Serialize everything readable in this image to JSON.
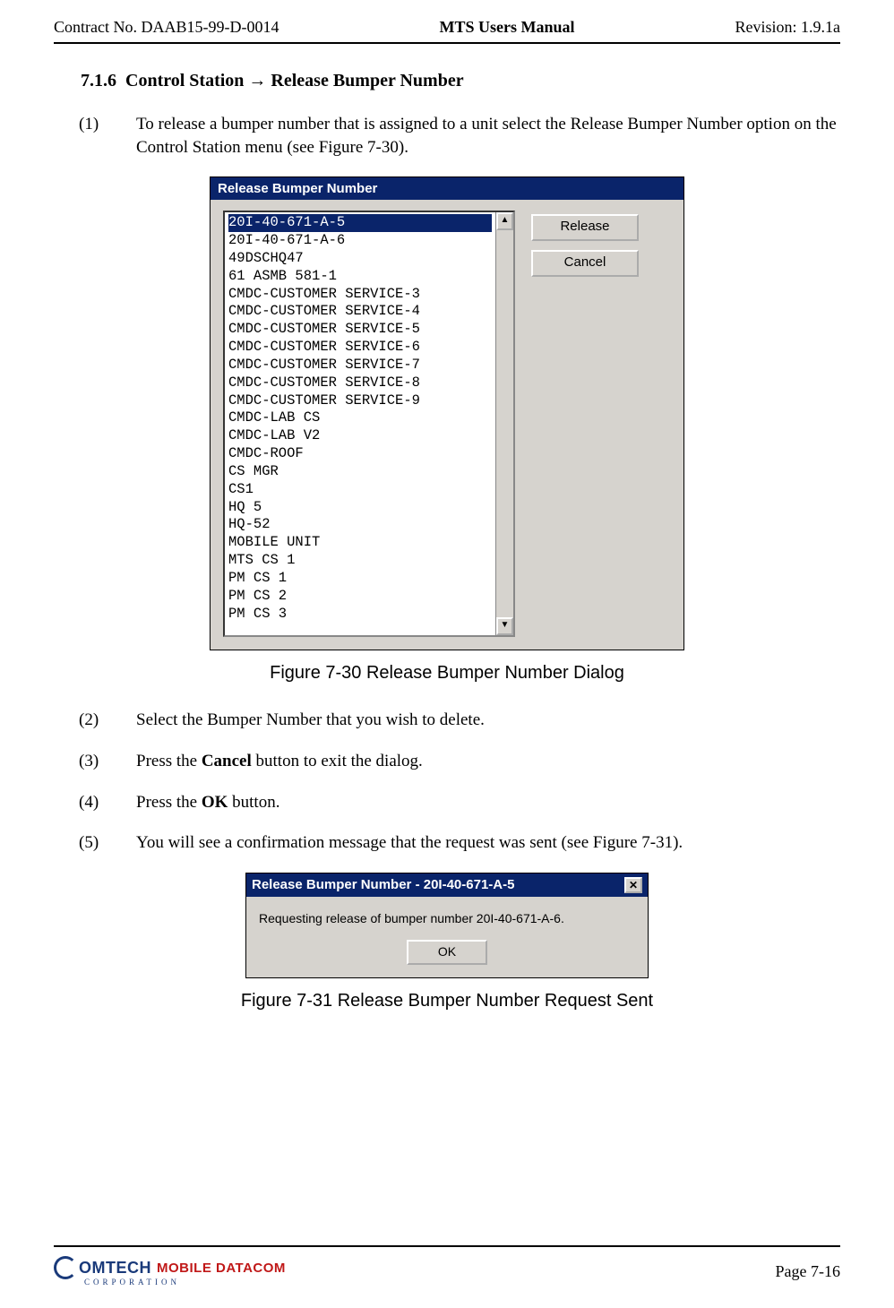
{
  "header": {
    "left": "Contract No. DAAB15-99-D-0014",
    "center": "MTS Users Manual",
    "right": "Revision:  1.9.1a"
  },
  "section": {
    "number": "7.1.6",
    "title_prefix": "Control Station",
    "arrow": "→",
    "title_suffix": "Release Bumper Number"
  },
  "steps": {
    "s1_num": "(1)",
    "s1_text": "To release a bumper number that is assigned to a unit select the Release Bumper Number option on the Control Station menu (see Figure 7-30).",
    "s2_num": "(2)",
    "s2_text": "Select the Bumper Number that you wish to delete.",
    "s3_num": "(3)",
    "s3_pre": "Press the ",
    "s3_bold": "Cancel",
    "s3_post": " button to exit the dialog.",
    "s4_num": "(4)",
    "s4_pre": "Press the ",
    "s4_bold": "OK",
    "s4_post": " button.",
    "s5_num": "(5)",
    "s5_text": "You will see a confirmation message that the request was sent (see Figure 7-31)."
  },
  "dialog1": {
    "title": "Release Bumper Number",
    "release_label": "Release",
    "cancel_label": "Cancel",
    "items": [
      "20I-40-671-A-5",
      "20I-40-671-A-6",
      "49DSCHQ47",
      "61 ASMB 581-1",
      "CMDC-CUSTOMER SERVICE-3",
      "CMDC-CUSTOMER SERVICE-4",
      "CMDC-CUSTOMER SERVICE-5",
      "CMDC-CUSTOMER SERVICE-6",
      "CMDC-CUSTOMER SERVICE-7",
      "CMDC-CUSTOMER SERVICE-8",
      "CMDC-CUSTOMER SERVICE-9",
      "CMDC-LAB CS",
      "CMDC-LAB V2",
      "CMDC-ROOF",
      "CS MGR",
      "CS1",
      "HQ 5",
      "HQ-52",
      "MOBILE UNIT",
      "MTS CS 1",
      "PM CS 1",
      "PM CS 2",
      "PM CS 3"
    ]
  },
  "figure1_caption": "Figure 7-30   Release Bumper Number Dialog",
  "dialog2": {
    "title": "Release Bumper Number - 20I-40-671-A-5",
    "close_glyph": "✕",
    "message": "Requesting release of bumper number  20I-40-671-A-6.",
    "ok_label": "OK"
  },
  "figure2_caption": "Figure 7-31   Release Bumper Number Request Sent",
  "footer": {
    "logo_main": "OMTECH",
    "logo_side": "MOBILE DATACOM",
    "logo_sub": "CORPORATION",
    "page": "Page 7-16"
  }
}
